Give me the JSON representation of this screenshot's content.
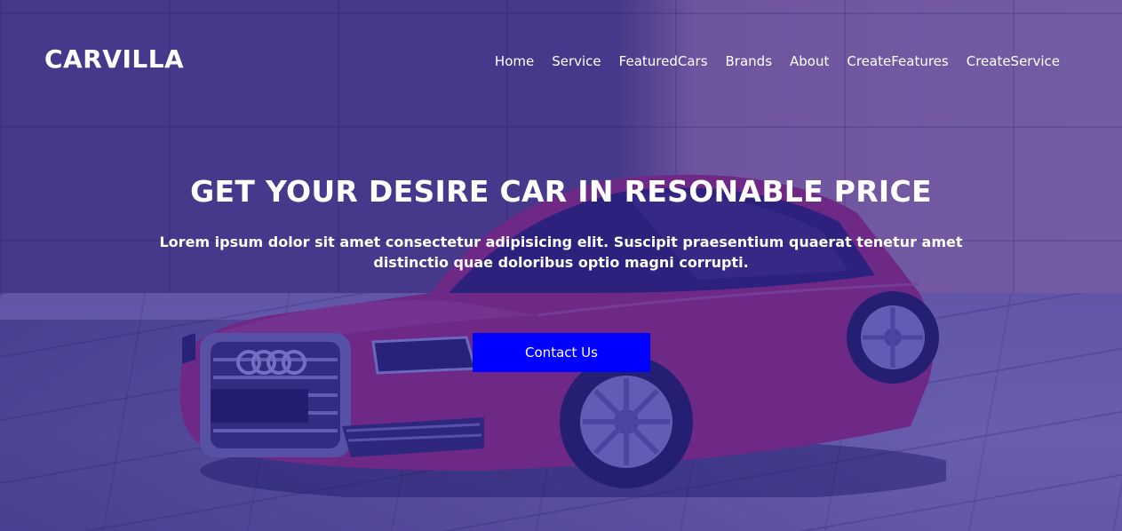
{
  "brand": {
    "name": "CARVILLA"
  },
  "nav": {
    "items": [
      {
        "label": "Home"
      },
      {
        "label": "Service"
      },
      {
        "label": "FeaturedCars"
      },
      {
        "label": "Brands"
      },
      {
        "label": "About"
      },
      {
        "label": "CreateFeatures"
      },
      {
        "label": "CreateService"
      }
    ]
  },
  "hero": {
    "headline": "GET YOUR DESIRE CAR IN RESONABLE PRICE",
    "subtext": "Lorem ipsum dolor sit amet consectetur adipisicing elit. Suscipit praesentium quaerat tenetur amet distinctio quae doloribus optio magni corrupti.",
    "cta_label": "Contact Us"
  },
  "colors": {
    "overlay": "#2d23aa",
    "cta_background": "#0000ff",
    "text": "#ffffff"
  }
}
